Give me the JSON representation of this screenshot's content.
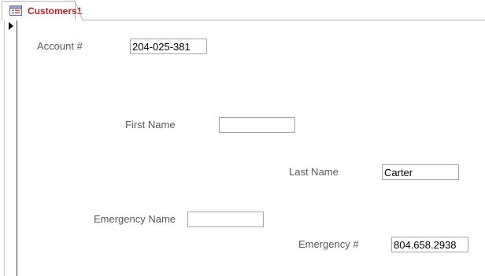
{
  "tab": {
    "title": "Customers1",
    "icon": "form-icon"
  },
  "record_selector": {
    "icon": "current-record-arrow-icon"
  },
  "fields": {
    "account": {
      "label": "Account #",
      "value": "204-025-381"
    },
    "first_name": {
      "label": "First Name",
      "value": ""
    },
    "last_name": {
      "label": "Last Name",
      "value": "Carter"
    },
    "emergency_name": {
      "label": "Emergency Name",
      "value": ""
    },
    "emergency_phone": {
      "label": "Emergency #",
      "value": "804.658.2938"
    }
  },
  "colors": {
    "tab_text": "#a4262c",
    "label_text": "#595959",
    "field_border": "#a6a6a6"
  }
}
